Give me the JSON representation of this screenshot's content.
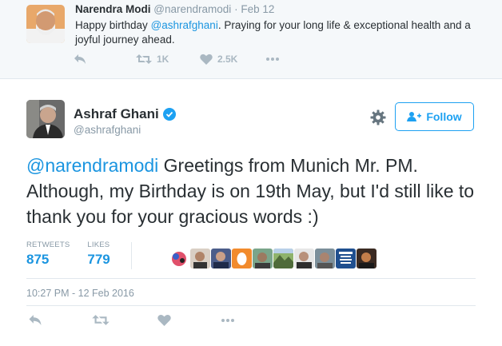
{
  "reply_tweet": {
    "fullname": "Narendra Modi",
    "handle": "@narendramodi",
    "separator": "·",
    "date": "Feb 12",
    "text_before": "Happy birthday ",
    "mention": "@ashrafghani",
    "text_after": ". Praying for your long life & exceptional health and a joyful journey ahead.",
    "retweet_count": "1K",
    "like_count": "2.5K"
  },
  "main_tweet": {
    "fullname": "Ashraf Ghani",
    "handle": "@ashrafghani",
    "follow_label": "Follow",
    "mention": "@narendramodi",
    "text": " Greetings from Munich Mr. PM. Although, my Birthday is on 19th May, but I'd still like to thank you for your gracious words :)",
    "retweets_label": "RETWEETS",
    "retweets_value": "875",
    "likes_label": "LIKES",
    "likes_value": "779",
    "timestamp": "10:27 PM - 12 Feb 2016",
    "likers_count": 10
  },
  "icons": [
    "reply-icon",
    "retweet-icon",
    "like-icon",
    "more-icon",
    "gear-icon",
    "follow-icon",
    "verified-icon"
  ],
  "colors": {
    "accent": "#1da1f2",
    "link": "#1b95e0",
    "muted": "#8899a6",
    "action_gray": "#aab8c2",
    "top_bg": "#f5f8fa"
  }
}
